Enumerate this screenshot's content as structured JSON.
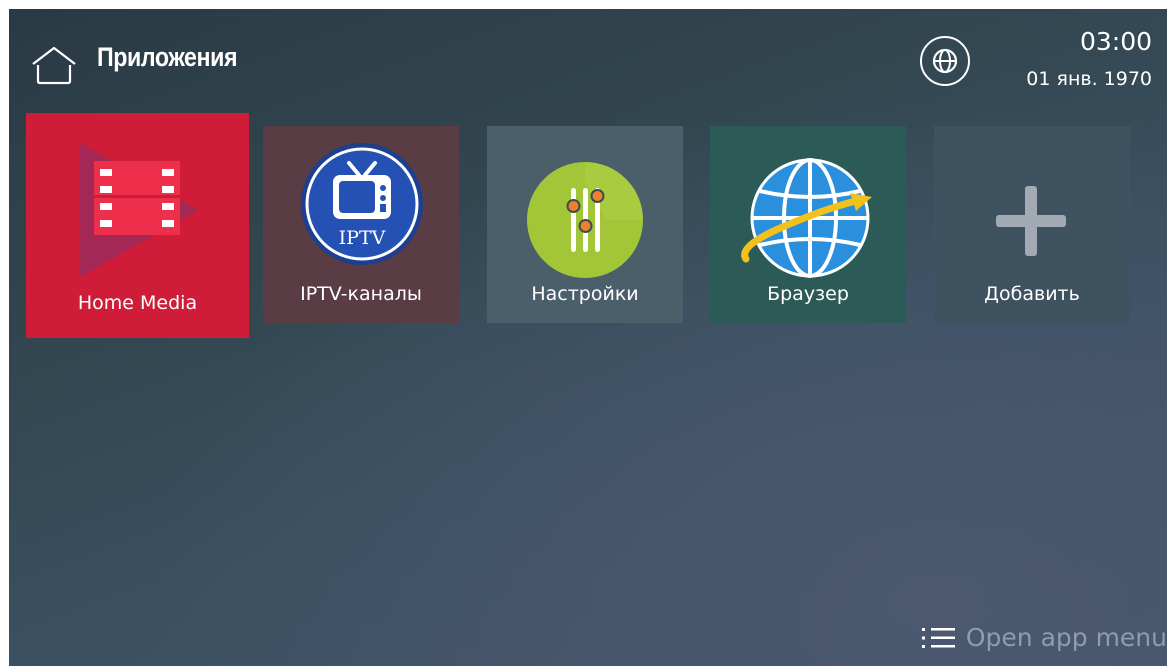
{
  "header": {
    "title": "Приложения",
    "time": "03:00",
    "date": "01 янв. 1970"
  },
  "apps": [
    {
      "label": "Home Media",
      "icon": "play-movies-icon",
      "color": "#cf1d39",
      "focused": true
    },
    {
      "label": "IPTV-каналы",
      "icon": "iptv-tv-icon",
      "color": "#5a3c44",
      "badge": "IPTV"
    },
    {
      "label": "Настройки",
      "icon": "equalizer-sliders-icon",
      "color": "#4b5f6b"
    },
    {
      "label": "Браузер",
      "icon": "globe-orbit-icon",
      "color": "#2c5a57"
    },
    {
      "label": "Добавить",
      "icon": "plus-icon",
      "color": "#3e5260"
    }
  ],
  "footer": {
    "menu_hint": "Open app menu"
  }
}
